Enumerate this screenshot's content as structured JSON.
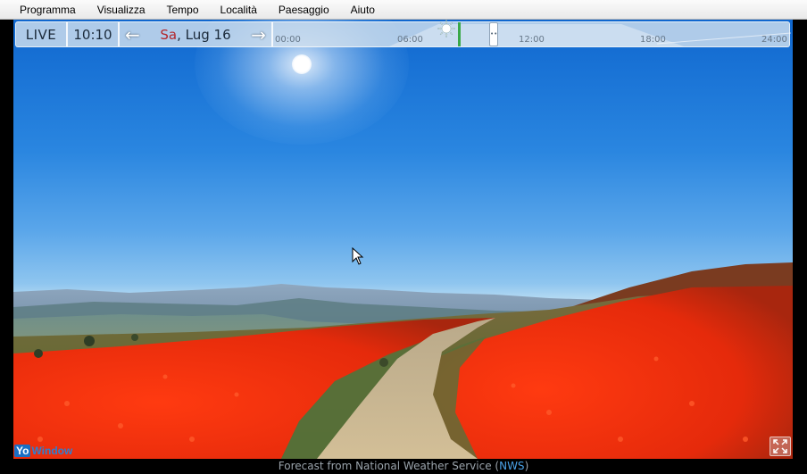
{
  "menu": {
    "items": [
      "Programma",
      "Visualizza",
      "Tempo",
      "Località",
      "Paesaggio",
      "Aiuto"
    ]
  },
  "timebar": {
    "live_label": "LIVE",
    "time": "10:10",
    "date_day": "Sa",
    "date_rest": ", Lug 16",
    "left_arrow_icon": "arrow-left-icon",
    "right_arrow_icon": "arrow-right-icon",
    "ticks": [
      "00:00",
      "06:00",
      "12:00",
      "18:00",
      "24:00"
    ]
  },
  "branding": {
    "logo_part1": "Yo",
    "logo_part2": "Window"
  },
  "footer": {
    "prefix": "Forecast from National Weather Service (",
    "link": "NWS",
    "suffix": ")"
  },
  "colors": {
    "sky_top": "#0f67cf",
    "now_line": "#3aa84a",
    "weekday": "#b3262b",
    "link": "#4aa1e6"
  }
}
